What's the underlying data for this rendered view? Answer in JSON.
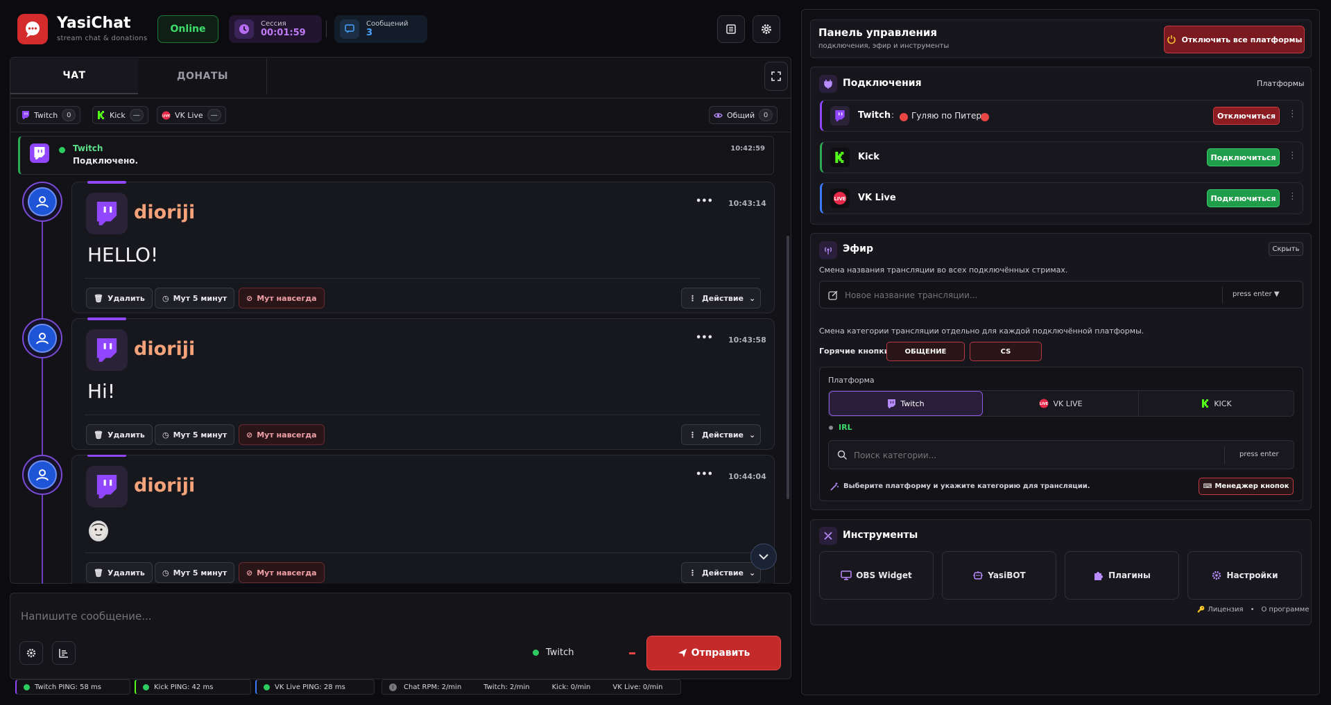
{
  "app": {
    "name": "YasiChat",
    "subtitle": "stream chat & donations",
    "status": "Online"
  },
  "header": {
    "session_label": "Сессия",
    "session_value": "00:01:59",
    "messages_label": "Сообщений",
    "messages_value": "3"
  },
  "tabs": [
    {
      "label": "ЧАТ"
    },
    {
      "label": "ДОНАТЫ"
    }
  ],
  "filters": [
    {
      "label": "Twitch",
      "count": "0"
    },
    {
      "label": "Kick",
      "count": "—"
    },
    {
      "label": "VK Live",
      "count": "—"
    }
  ],
  "filter_all": {
    "label": "Общий",
    "count": "0"
  },
  "system_msg": {
    "platform": "Twitch",
    "text": "Подключено.",
    "time": "10:42:59"
  },
  "messages": [
    {
      "user": "dioriji",
      "text": "HELLO!",
      "time": "10:43:14"
    },
    {
      "user": "dioriji",
      "text": "Hi!",
      "time": "10:43:58"
    },
    {
      "user": "dioriji",
      "text": "",
      "time": "10:44:04"
    }
  ],
  "msg_actions": {
    "delete": "Удалить",
    "mute5": "Мут 5 минут",
    "mute_forever": "Мут навсегда",
    "action": "Действие",
    "more": "•••"
  },
  "composer": {
    "placeholder": "Напишите сообщение...",
    "platform": "Twitch",
    "send": "Отправить"
  },
  "footer": {
    "pings": [
      "Twitch PING: 58 ms",
      "Kick PING: 42 ms",
      "VK Live PING: 28 ms"
    ],
    "rpm": [
      "Chat RPM: 2/min",
      "Twitch: 2/min",
      "Kick: 0/min",
      "VK Live: 0/min"
    ]
  },
  "control": {
    "title": "Панель управления",
    "subtitle": "подключения, эфир и инструменты",
    "disconnect_all": "Отключить все платформы"
  },
  "connections": {
    "title": "Подключения",
    "right_label": "Платформы",
    "rows": [
      {
        "name": "Twitch",
        "sep": ":",
        "stream_title": "Гуляю по Питеру",
        "button": "Отключиться"
      },
      {
        "name": "Kick",
        "button": "Подключиться"
      },
      {
        "name": "VK Live",
        "button": "Подключиться"
      }
    ]
  },
  "broadcast": {
    "title": "Эфир",
    "hide": "Скрыть",
    "title_desc": "Смена названия трансляции во всех подключённых стримах.",
    "title_placeholder": "Новое название трансляции...",
    "press_enter": "press enter ▼",
    "category_desc": "Смена категории трансляции отдельно для каждой подключённой платформы.",
    "hotkeys_label": "Горячие кнопки:",
    "hotkeys": [
      "ОБЩЕНИЕ",
      "CS"
    ],
    "platform_label": "Платформа",
    "platform_tabs": [
      "Twitch",
      "VK LIVE",
      "KICK"
    ],
    "current_category": "IRL",
    "category_placeholder": "Поиск категории...",
    "press_enter2": "press enter",
    "hint": "Выберите платформу и укажите категорию для трансляции.",
    "manager": "Менеджер кнопок"
  },
  "tools": {
    "title": "Инструменты",
    "items": [
      "OBS Widget",
      "YasiBOT",
      "Плагины",
      "Настройки"
    ],
    "license": "Лицензия",
    "dot": "•",
    "about": "О программе"
  },
  "colors": {
    "accent": "#d42c2c",
    "twitch": "#9146ff",
    "kick": "#53fc18",
    "online": "#3ddc6b",
    "username": "#f4a27a"
  }
}
